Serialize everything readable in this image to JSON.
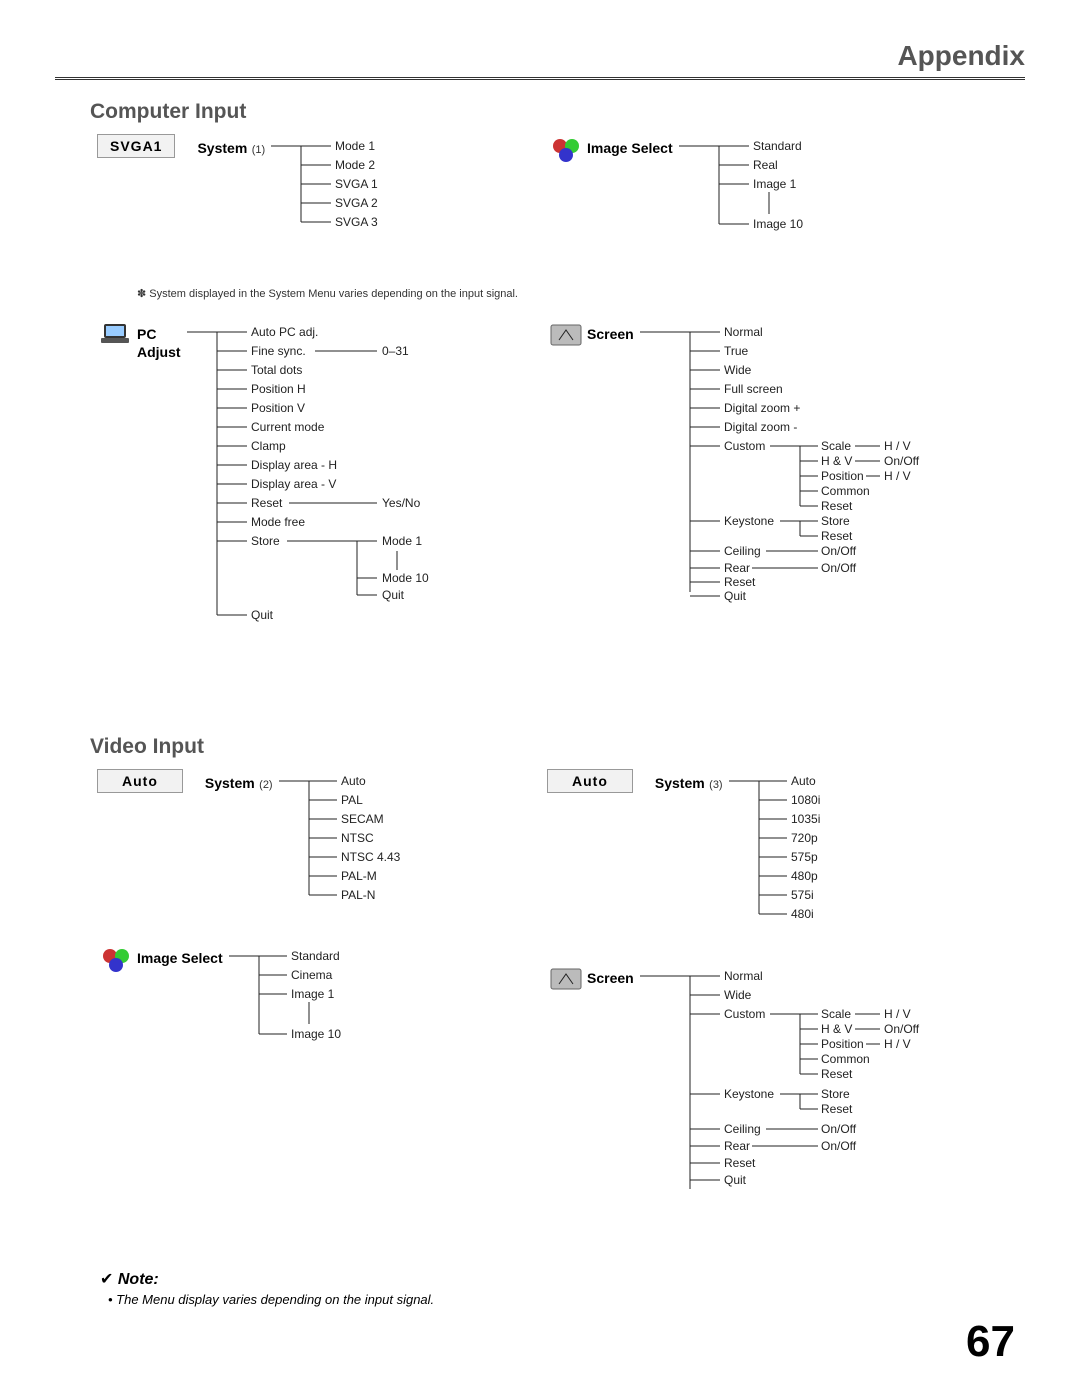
{
  "page_title": "Appendix",
  "page_number": "67",
  "sections": {
    "computer_input": "Computer Input",
    "video_input": "Video Input"
  },
  "badges": {
    "svga1": "SVGA1",
    "auto1": "Auto",
    "auto2": "Auto"
  },
  "menus": {
    "system1": {
      "label": "System",
      "sup": "(1)"
    },
    "system2": {
      "label": "System",
      "sup": "(2)"
    },
    "system3": {
      "label": "System",
      "sup": "(3)"
    },
    "imgsel1": {
      "label": "Image Select"
    },
    "imgsel2": {
      "label": "Image Select"
    },
    "pcadjust": {
      "label": "PC Adjust"
    },
    "screen1": {
      "label": "Screen"
    },
    "screen2": {
      "label": "Screen"
    }
  },
  "system1_items": [
    "Mode 1",
    "Mode 2",
    "SVGA 1",
    "SVGA 2",
    "SVGA 3"
  ],
  "imgsel1_items": [
    "Standard",
    "Real",
    "Image 1",
    "Image 10"
  ],
  "pcadjust_items": [
    "Auto PC adj.",
    "Fine sync.",
    "Total dots",
    "Position H",
    "Position V",
    "Current mode",
    "Clamp",
    "Display area - H",
    "Display area - V",
    "Reset",
    "Mode free",
    "Store",
    "Quit"
  ],
  "pcadjust_annot": {
    "finesync": "0–31",
    "reset": "Yes/No",
    "store_a": "Mode 1",
    "store_b": "Mode 10",
    "store_c": "Quit"
  },
  "screen1_items": [
    "Normal",
    "True",
    "Wide",
    "Full screen",
    "Digital zoom +",
    "Digital zoom -",
    "Custom",
    "Keystone",
    "Ceiling",
    "Rear",
    "Reset",
    "Quit"
  ],
  "custom_sub": {
    "scale": "Scale",
    "scale_v": "H / V",
    "hv": "H & V",
    "hv_v": "On/Off",
    "pos": "Position",
    "pos_v": "H / V",
    "common": "Common",
    "reset": "Reset"
  },
  "keystone_sub": {
    "store": "Store",
    "reset": "Reset"
  },
  "ceiling_v": "On/Off",
  "rear_v": "On/Off",
  "system2_items": [
    "Auto",
    "PAL",
    "SECAM",
    "NTSC",
    "NTSC 4.43",
    "PAL-M",
    "PAL-N"
  ],
  "system3_items": [
    "Auto",
    "1080i",
    "1035i",
    "720p",
    "575p",
    "480p",
    "575i",
    "480i"
  ],
  "imgsel2_items": [
    "Standard",
    "Cinema",
    "Image 1",
    "Image 10"
  ],
  "screen2_items": [
    "Normal",
    "Wide",
    "Custom",
    "Keystone",
    "Ceiling",
    "Rear",
    "Reset",
    "Quit"
  ],
  "footnote_system": "✽ System displayed in the System Menu varies depending on the input signal.",
  "note_check": "✔",
  "note_label": "Note:",
  "note_text": "• The Menu display varies depending on the input signal."
}
